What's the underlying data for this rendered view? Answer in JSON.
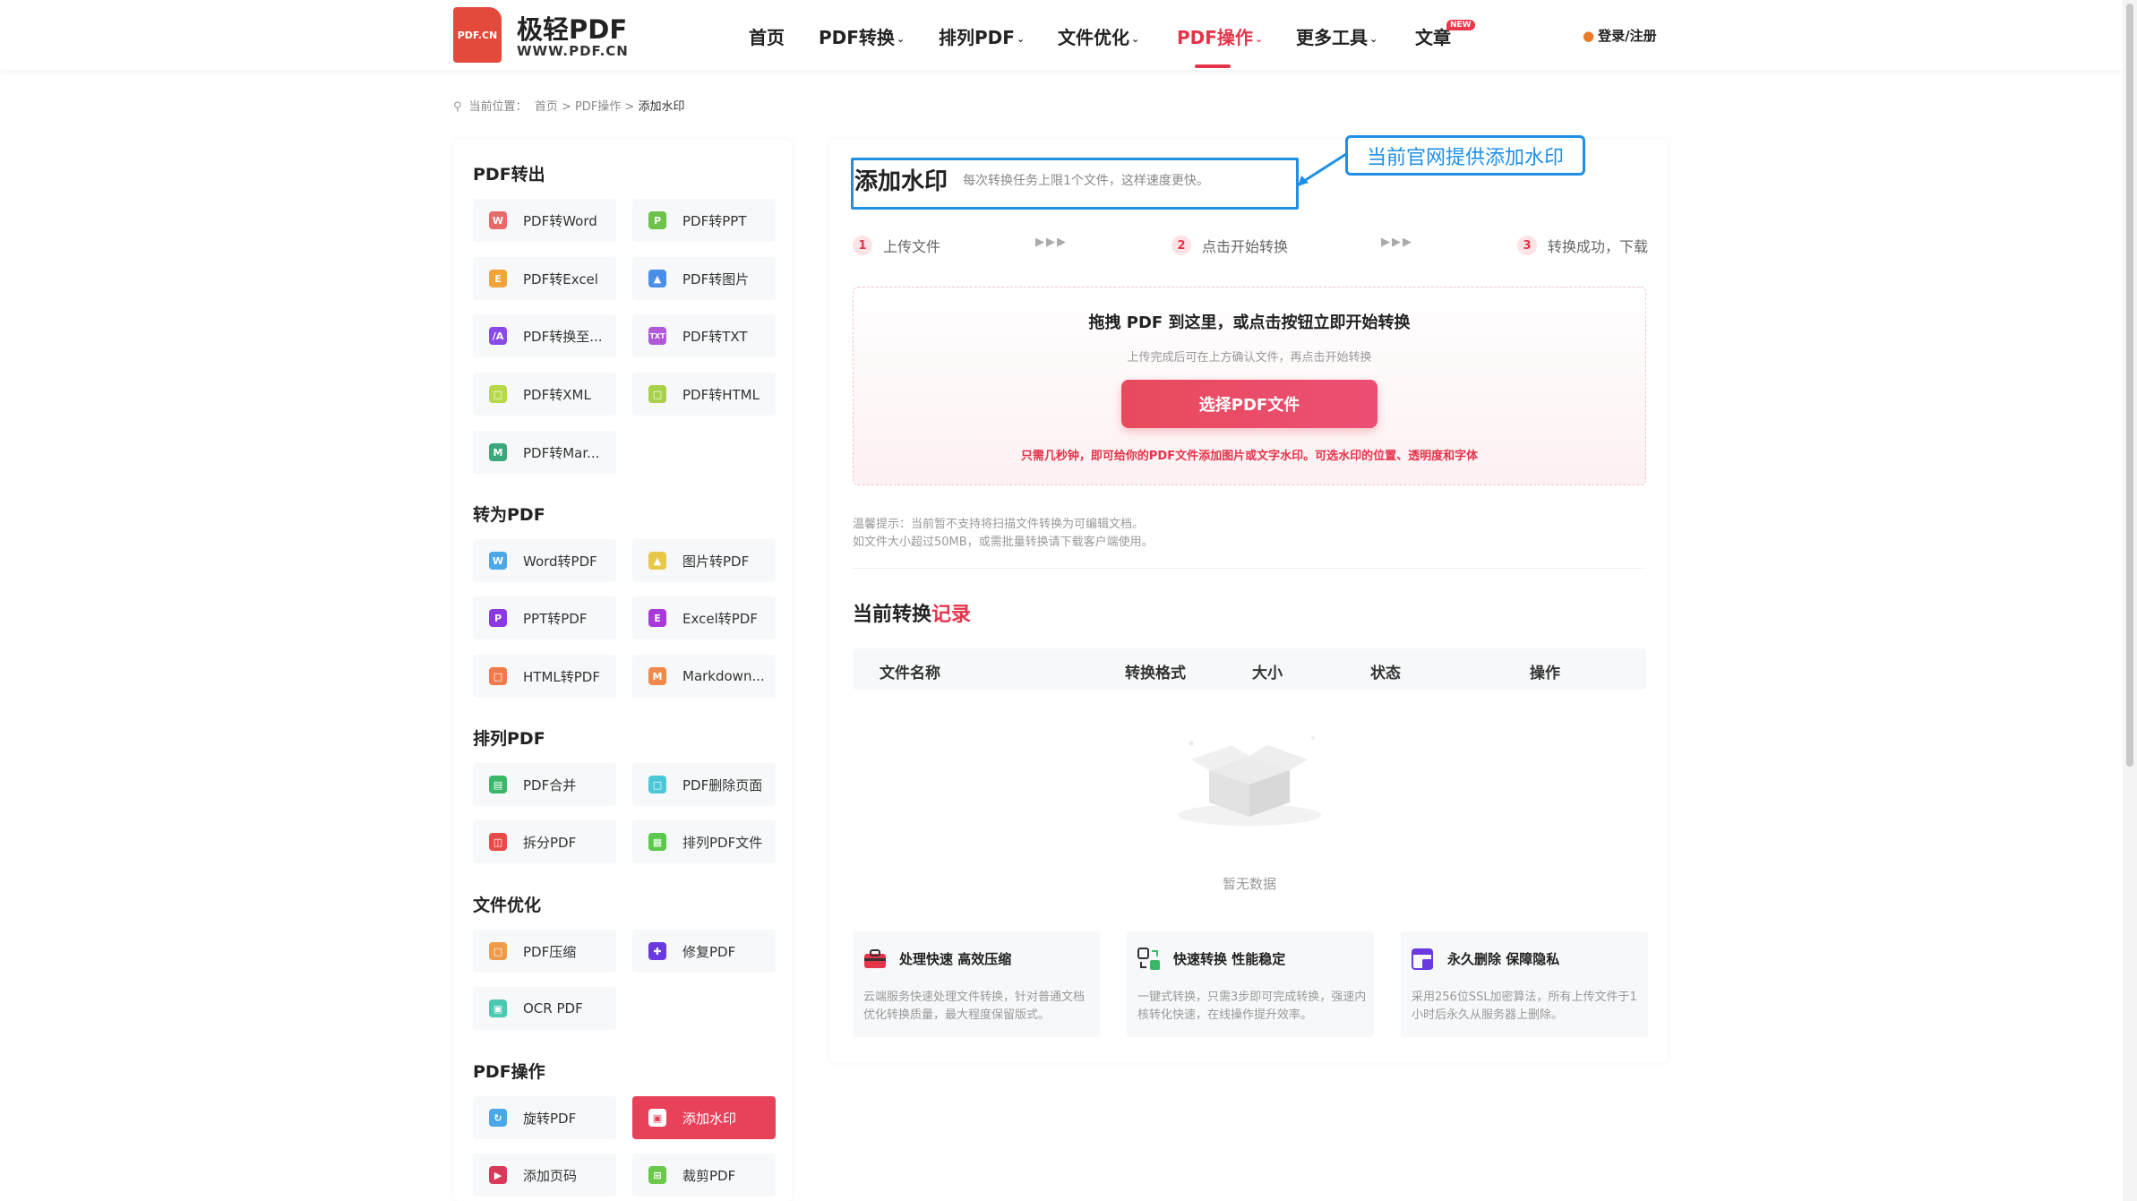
{
  "header": {
    "logo_badge": "PDF.CN",
    "logo_title": "极轻PDF",
    "logo_sub": "WWW.PDF.CN",
    "nav": [
      {
        "label": "首页"
      },
      {
        "label": "PDF转换"
      },
      {
        "label": "排列PDF"
      },
      {
        "label": "文件优化"
      },
      {
        "label": "PDF操作"
      },
      {
        "label": "更多工具"
      },
      {
        "label": "文章"
      }
    ],
    "new_badge": "NEW",
    "login": "登录/注册",
    "active_color": "#e5334a"
  },
  "breadcrumb": {
    "prefix": "当前位置：",
    "path": "首页 > PDF操作 > ",
    "current": "添加水印"
  },
  "sidebar": {
    "sections": [
      {
        "title": "PDF转出",
        "items": [
          {
            "label": "PDF转Word",
            "icon": "W",
            "color": "#e86a6a"
          },
          {
            "label": "PDF转PPT",
            "icon": "P",
            "color": "#6cc24a"
          },
          {
            "label": "PDF转Excel",
            "icon": "E",
            "color": "#f0a43a"
          },
          {
            "label": "PDF转图片",
            "icon": "image-icon",
            "color": "#4a8ee8"
          },
          {
            "label": "PDF转换至...",
            "icon": "/A",
            "color": "#8a4ae8"
          },
          {
            "label": "PDF转TXT",
            "icon": "TXT",
            "color": "#b05ad8"
          },
          {
            "label": "PDF转XML",
            "icon": "X",
            "color": "#b8d84a"
          },
          {
            "label": "PDF转HTML",
            "icon": "H",
            "color": "#a8d04a"
          },
          {
            "label": "PDF转Mar...",
            "icon": "M",
            "color": "#3aa87a"
          }
        ]
      },
      {
        "title": "转为PDF",
        "items": [
          {
            "label": "Word转PDF",
            "icon": "W",
            "color": "#4aa8e8"
          },
          {
            "label": "图片转PDF",
            "icon": "image-icon",
            "color": "#e8c84a"
          },
          {
            "label": "PPT转PDF",
            "icon": "P",
            "color": "#8a3ae0"
          },
          {
            "label": "Excel转PDF",
            "icon": "E",
            "color": "#a83ad8"
          },
          {
            "label": "HTML转PDF",
            "icon": "H",
            "color": "#f07a4a"
          },
          {
            "label": "Markdown...",
            "icon": "M",
            "color": "#f08a4a"
          }
        ]
      },
      {
        "title": "排列PDF",
        "items": [
          {
            "label": "PDF合并",
            "icon": "merge-icon",
            "color": "#3ab86a"
          },
          {
            "label": "PDF删除页面",
            "icon": "delete-icon",
            "color": "#4ac8d8"
          },
          {
            "label": "拆分PDF",
            "icon": "split-icon",
            "color": "#e84a4a"
          },
          {
            "label": "排列PDF文件",
            "icon": "grid-icon",
            "color": "#5ac84a"
          }
        ]
      },
      {
        "title": "文件优化",
        "items": [
          {
            "label": "PDF压缩",
            "icon": "compress-icon",
            "color": "#f09a4a"
          },
          {
            "label": "修复PDF",
            "icon": "repair-icon",
            "color": "#6a3ae0"
          },
          {
            "label": "OCR PDF",
            "icon": "ocr-icon",
            "color": "#4ac8b0"
          }
        ]
      },
      {
        "title": "PDF操作",
        "items": [
          {
            "label": "旋转PDF",
            "icon": "rotate-icon",
            "color": "#4aa8e8"
          },
          {
            "label": "添加水印",
            "icon": "watermark-icon",
            "color": "#e8415a"
          },
          {
            "label": "添加页码",
            "icon": "page-number-icon",
            "color": "#d83a5a"
          },
          {
            "label": "裁剪PDF",
            "icon": "crop-icon",
            "color": "#6ac84a"
          }
        ]
      }
    ],
    "active_label": "添加水印"
  },
  "main": {
    "title": "添加水印",
    "desc": "每次转换任务上限1个文件，这样速度更快。",
    "callout": "当前官网提供添加水印",
    "steps": [
      {
        "num": "1",
        "label": "上传文件"
      },
      {
        "num": "2",
        "label": "点击开始转换"
      },
      {
        "num": "3",
        "label": "转换成功，下载"
      }
    ],
    "step_arrows": "▶▶▶",
    "drop": {
      "title": "拖拽 PDF 到这里，或点击按钮立即开始转换",
      "sub": "上传完成后可在上方确认文件，再点击开始转换",
      "button": "选择PDF文件",
      "note": "只需几秒钟，即可给你的PDF文件添加图片或文字水印。可选水印的位置、透明度和字体"
    },
    "tips": [
      "温馨提示：当前暂不支持将扫描文件转换为可编辑文档。",
      "如文件大小超过50MB，或需批量转换请下载客户端使用。"
    ],
    "record_title_a": "当前转换",
    "record_title_b": "记录",
    "table_headers": [
      "文件名称",
      "转换格式",
      "大小",
      "状态",
      "操作"
    ],
    "empty": "暂无数据",
    "features": [
      {
        "title": "处理快速 高效压缩",
        "desc": "云端服务快速处理文件转换，针对普通文档优化转换质量，最大程度保留版式。",
        "icon": "toolbox-icon"
      },
      {
        "title": "快速转换 性能稳定",
        "desc": "一键式转换，只需3步即可完成转换，强速内核转化快速，在线操作提升效率。",
        "icon": "convert-icon"
      },
      {
        "title": "永久删除 保障隐私",
        "desc": "采用256位SSL加密算法，所有上传文件于1小时后永久从服务器上删除。",
        "icon": "privacy-icon"
      }
    ]
  }
}
